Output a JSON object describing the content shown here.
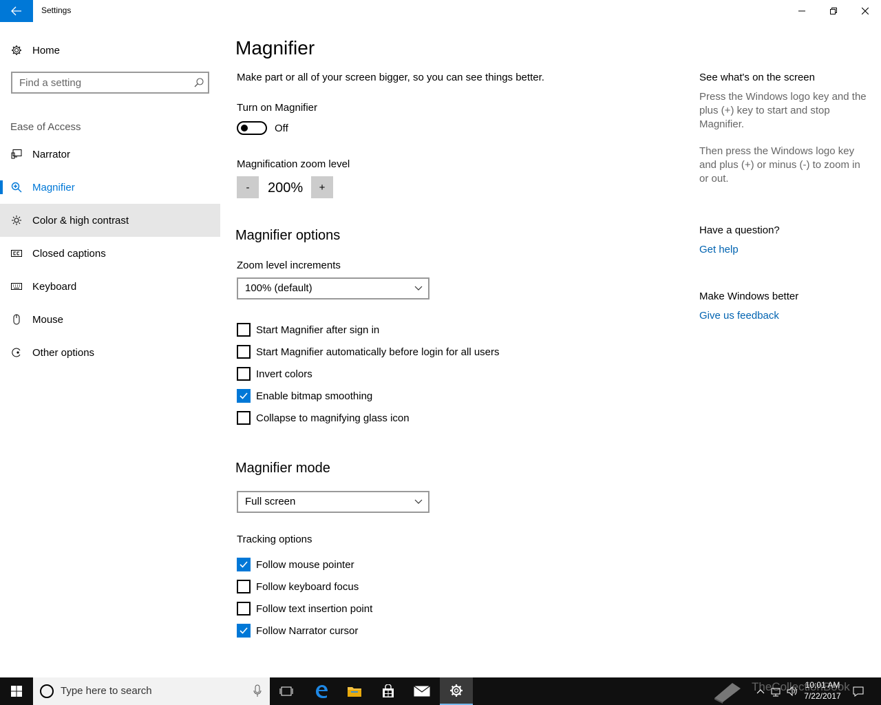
{
  "window": {
    "title": "Settings"
  },
  "sidebar": {
    "home_label": "Home",
    "search_placeholder": "Find a setting",
    "section_label": "Ease of Access",
    "items": [
      {
        "label": "Narrator",
        "icon": "narrator-icon"
      },
      {
        "label": "Magnifier",
        "icon": "magnifier-icon",
        "selected": true
      },
      {
        "label": "Color & high contrast",
        "icon": "brightness-icon",
        "hover": true
      },
      {
        "label": "Closed captions",
        "icon": "cc-icon"
      },
      {
        "label": "Keyboard",
        "icon": "keyboard-icon"
      },
      {
        "label": "Mouse",
        "icon": "mouse-icon"
      },
      {
        "label": "Other options",
        "icon": "other-options-icon"
      }
    ]
  },
  "main": {
    "title": "Magnifier",
    "description": "Make part or all of your screen bigger, so you can see things better.",
    "turn_on_label": "Turn on Magnifier",
    "toggle_state": "Off",
    "zoom_label": "Magnification zoom level",
    "zoom_minus": "-",
    "zoom_value": "200%",
    "zoom_plus": "+",
    "options_heading": "Magnifier options",
    "increments_label": "Zoom level increments",
    "increments_value": "100% (default)",
    "options": [
      {
        "label": "Start Magnifier after sign in",
        "checked": false
      },
      {
        "label": "Start Magnifier automatically before login for all users",
        "checked": false
      },
      {
        "label": "Invert colors",
        "checked": false
      },
      {
        "label": "Enable bitmap smoothing",
        "checked": true
      },
      {
        "label": "Collapse to magnifying glass icon",
        "checked": false
      }
    ],
    "mode_heading": "Magnifier mode",
    "mode_value": "Full screen",
    "tracking_label": "Tracking options",
    "tracking": [
      {
        "label": "Follow mouse pointer",
        "checked": true
      },
      {
        "label": "Follow keyboard focus",
        "checked": false
      },
      {
        "label": "Follow text insertion point",
        "checked": false
      },
      {
        "label": "Follow Narrator cursor",
        "checked": true
      }
    ]
  },
  "right_panel": {
    "see_heading": "See what's on the screen",
    "see_text_1": "Press the Windows logo key and the plus (+) key to start and stop Magnifier.",
    "see_text_2": "Then press the Windows logo key and plus (+) or minus (-) to zoom in or out.",
    "question_heading": "Have a question?",
    "get_help": "Get help",
    "better_heading": "Make Windows better",
    "feedback": "Give us feedback"
  },
  "taskbar": {
    "search_placeholder": "Type here to search",
    "time": "10:01 AM",
    "date": "7/22/2017",
    "watermark": "TheCollectionBook"
  },
  "colors": {
    "accent": "#0078d7",
    "link": "#0063b1",
    "taskbar": "#101010"
  }
}
